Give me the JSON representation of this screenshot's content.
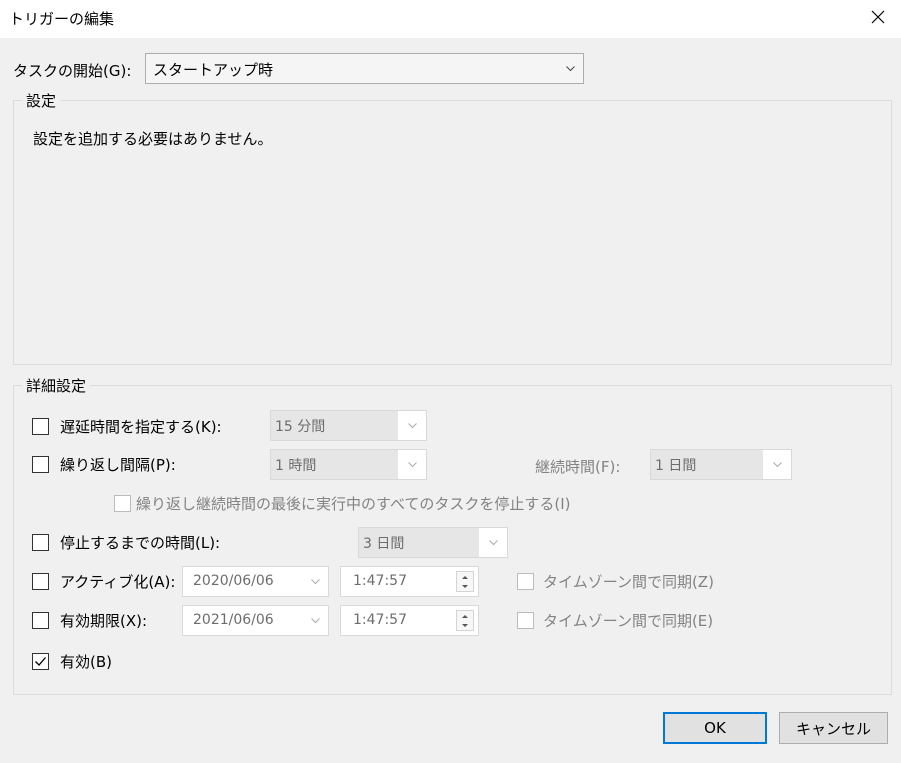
{
  "window": {
    "title": "トリガーの編集"
  },
  "begin_task": {
    "label": "タスクの開始(G):",
    "value": "スタートアップ時"
  },
  "settings_group": {
    "title": "設定",
    "message": "設定を追加する必要はありません。"
  },
  "advanced_group": {
    "title": "詳細設定",
    "delay": {
      "label": "遅延時間を指定する(K):",
      "value": "15 分間",
      "checked": false
    },
    "repeat": {
      "label": "繰り返し間隔(P):",
      "value": "1 時間",
      "checked": false
    },
    "duration": {
      "label": "継続時間(F):",
      "value": "1 日間"
    },
    "stop_all": {
      "label": "繰り返し継続時間の最後に実行中のすべてのタスクを停止する(I)",
      "checked": false
    },
    "stop_after": {
      "label": "停止するまでの時間(L):",
      "value": "3 日間",
      "checked": false
    },
    "activate": {
      "label": "アクティブ化(A):",
      "date": "2020/06/06",
      "time": "1:47:57",
      "sync_label": "タイムゾーン間で同期(Z)",
      "checked": false
    },
    "expire": {
      "label": "有効期限(X):",
      "date": "2021/06/06",
      "time": "1:47:57",
      "sync_label": "タイムゾーン間で同期(E)",
      "checked": false
    },
    "enabled": {
      "label": "有効(B)",
      "checked": true
    }
  },
  "buttons": {
    "ok": "OK",
    "cancel": "キャンセル"
  }
}
